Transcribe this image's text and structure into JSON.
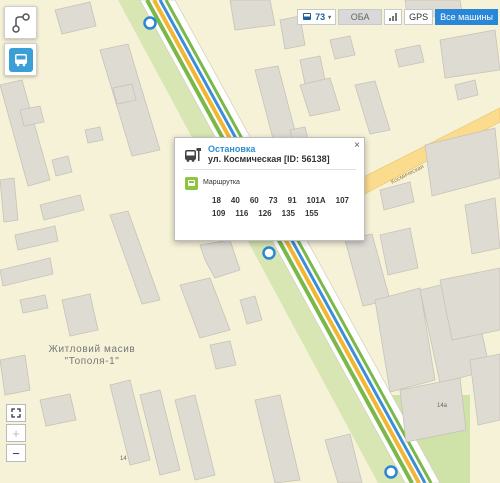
{
  "map": {
    "district_label_line1": "Житловий масив",
    "district_label_line2": "\"Тополя-1\"",
    "street_label": "Космическая",
    "house_numbers": [
      "14а",
      "14"
    ],
    "colors": {
      "background": "#f6f2d8",
      "building": "#dedbd3",
      "building_stroke": "#c7c3b8",
      "greenery": "#cfe2a8",
      "main_road": "#ffffff",
      "tram_green": "#7ab84a",
      "route_orange": "#f2b632",
      "route_blue": "#3a8fd6",
      "side_road": "#fbdb8d",
      "stop_marker": "#2a86d6"
    }
  },
  "controls": {
    "route_button_icon": "route-icon",
    "bus_button_icon": "bus-icon",
    "zoom_fullscreen_icon": "fullscreen-icon",
    "zoom_in": "+",
    "zoom_out": "−"
  },
  "topbar": {
    "bus_route_number": "73",
    "road_label": "ОБА",
    "gps_label": "GPS",
    "all_vehicles_label": "Все машины"
  },
  "popup": {
    "close": "×",
    "stop_kind": "Остановка",
    "stop_name": "ул. Космическая [ID: 56138]",
    "routes_label": "Маршрутка",
    "routes": [
      "18",
      "40",
      "60",
      "73",
      "91",
      "101А",
      "107",
      "109",
      "116",
      "126",
      "135",
      "155"
    ]
  }
}
